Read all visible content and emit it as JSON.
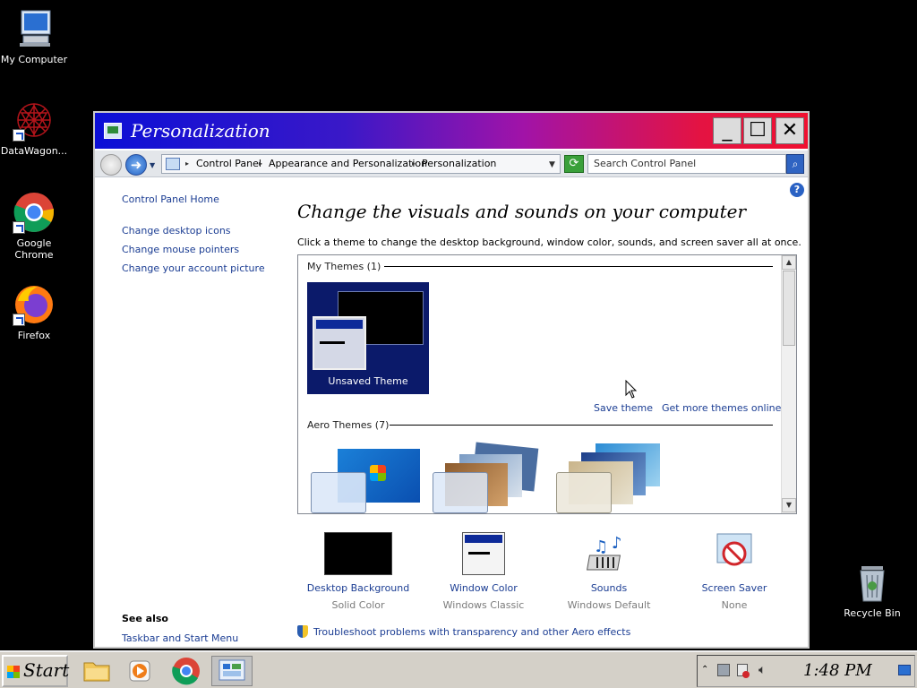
{
  "desktop": {
    "icons": [
      {
        "label": "My Computer"
      },
      {
        "label": "DataWagon..."
      },
      {
        "label": "Google Chrome"
      },
      {
        "label": "Firefox"
      },
      {
        "label": "Recycle Bin"
      }
    ]
  },
  "window": {
    "title": "Personalization",
    "buttons": {
      "minimize": "_",
      "maximize": "☐",
      "close": "✕"
    },
    "address": {
      "crumbs": [
        "Control Panel",
        "Appearance and Personalization",
        "Personalization"
      ],
      "search_placeholder": "Search Control Panel"
    },
    "left_pane": {
      "home": "Control Panel Home",
      "links": [
        "Change desktop icons",
        "Change mouse pointers",
        "Change your account picture"
      ],
      "see_also_title": "See also",
      "see_also_links": [
        "Taskbar and Start Menu"
      ]
    },
    "main": {
      "heading": "Change the visuals and sounds on your computer",
      "subheading": "Click a theme to change the desktop background, window color, sounds, and screen saver all at once.",
      "my_themes_header": "My Themes (1)",
      "my_themes": [
        {
          "label": "Unsaved Theme"
        }
      ],
      "save_theme": "Save theme",
      "get_more": "Get more themes online",
      "aero_themes_header": "Aero Themes (7)",
      "bottom_items": [
        {
          "label": "Desktop Background",
          "sub": "Solid Color"
        },
        {
          "label": "Window Color",
          "sub": "Windows Classic"
        },
        {
          "label": "Sounds",
          "sub": "Windows Default"
        },
        {
          "label": "Screen Saver",
          "sub": "None"
        }
      ],
      "troubleshoot": "Troubleshoot problems with transparency and other Aero effects"
    }
  },
  "taskbar": {
    "start_label": "Start",
    "clock": "1:48 PM"
  }
}
